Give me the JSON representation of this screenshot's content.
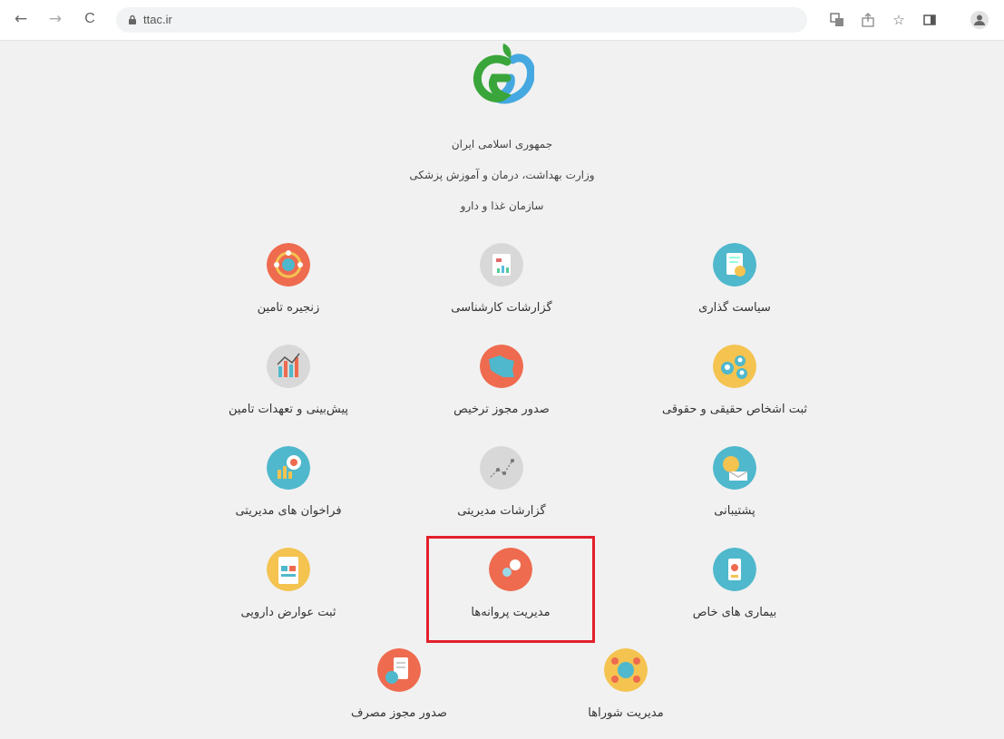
{
  "browser": {
    "url": "ttac.ir",
    "back_icon": "←",
    "forward_icon": "→",
    "reload_icon": "C",
    "translate_icon": "translate-icon",
    "share_icon": "share-icon",
    "bookmark_icon": "☆",
    "sidepanel_icon": "sidepanel-icon",
    "profile_icon": "profile-icon"
  },
  "header": {
    "line1": "جمهوری اسلامی ایران",
    "line2": "وزارت بهداشت، درمان و آموزش پزشکی",
    "line3": "سازمان غذا و دارو"
  },
  "tiles": [
    {
      "label": "سیاست گذاری",
      "icon": "policy-icon",
      "color": "#4fb8cc"
    },
    {
      "label": "گزارشات کارشناسی",
      "icon": "expert-report-icon",
      "color": "#d8d8d8"
    },
    {
      "label": "زنجیره تامین",
      "icon": "supply-chain-icon",
      "color": "#ee6b4f"
    },
    {
      "label": "ثبت اشخاص حقیقی و حقوقی",
      "icon": "people-register-icon",
      "color": "#f4c350"
    },
    {
      "label": "صدور مجوز ترخیص",
      "icon": "clearance-icon",
      "color": "#ee6b4f"
    },
    {
      "label": "پیش‌بینی و تعهدات تامین",
      "icon": "forecast-icon",
      "color": "#d8d8d8"
    },
    {
      "label": "پشتیبانی",
      "icon": "support-icon",
      "color": "#4fb8cc"
    },
    {
      "label": "گزارشات مدیریتی",
      "icon": "management-report-icon",
      "color": "#d8d8d8"
    },
    {
      "label": "فراخوان های مدیریتی",
      "icon": "recall-icon",
      "color": "#4fb8cc"
    },
    {
      "label": "بیماری های خاص",
      "icon": "special-disease-icon",
      "color": "#4fb8cc"
    },
    {
      "label": "مدیریت پروانه‌ها",
      "icon": "license-management-icon",
      "color": "#ee6b4f"
    },
    {
      "label": "ثبت عوارض دارویی",
      "icon": "adverse-effects-icon",
      "color": "#f4c350"
    },
    {
      "label": "مدیریت شوراها",
      "icon": "councils-icon",
      "color": "#f4c350"
    },
    {
      "label": "صدور مجوز مصرف",
      "icon": "usage-permit-icon",
      "color": "#ee6b4f"
    }
  ],
  "highlight_color": "#e3202c"
}
